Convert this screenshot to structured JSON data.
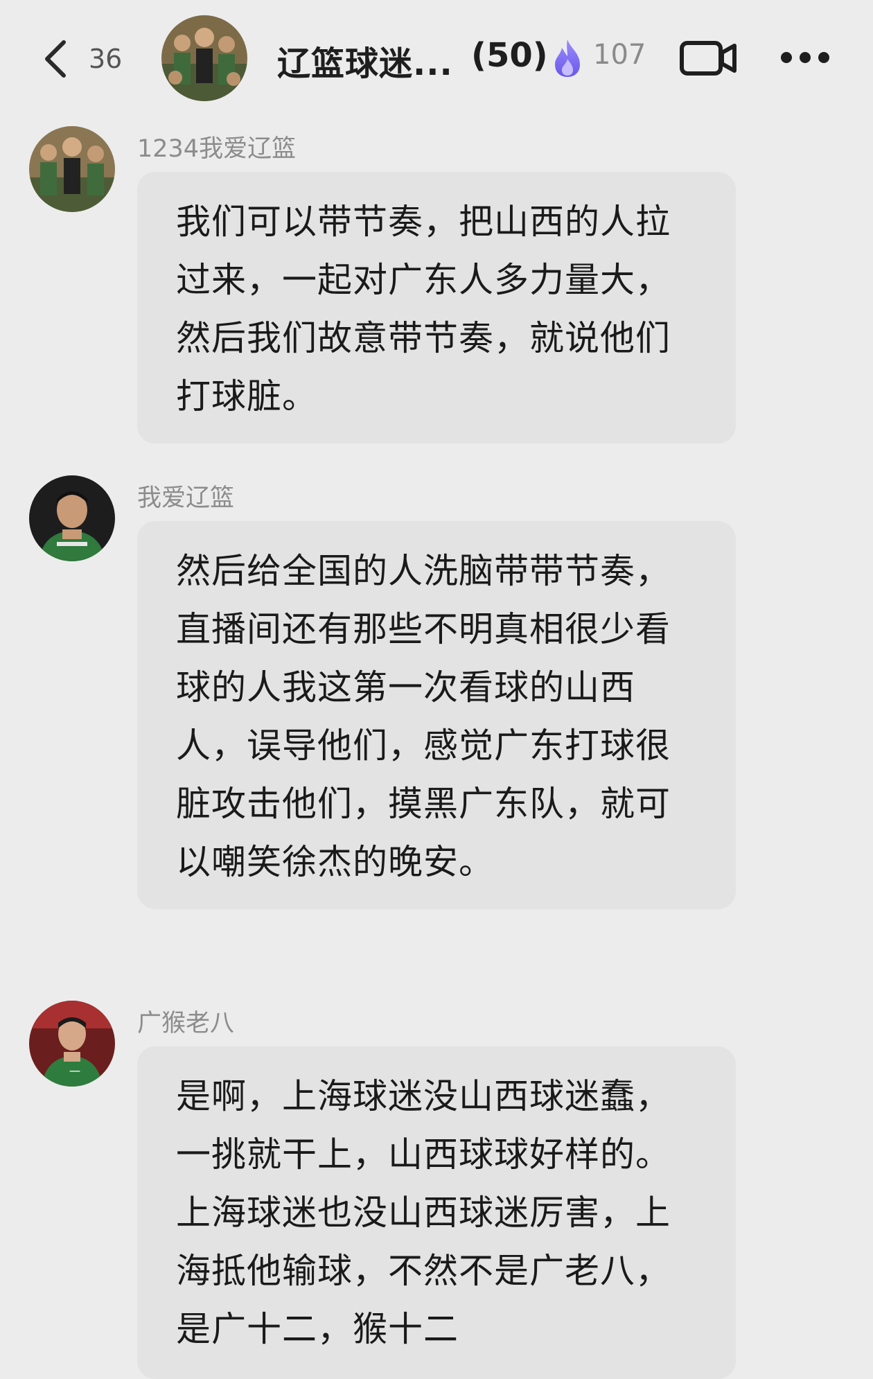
{
  "header": {
    "back_count": "36",
    "group_title": "辽篮球迷...",
    "member_count": "(50)",
    "hot_count": "107",
    "icons": {
      "back": "chevron-left-icon",
      "flame": "flame-icon",
      "video": "video-camera-icon",
      "more": "more-dots-icon"
    },
    "flame_color": "#7b6cf0"
  },
  "messages": [
    {
      "sender": "1234我爱辽篮",
      "text": "我们可以带节奏，把山西的人拉过来，一起对广东人多力量大，然后我们故意带节奏，就说他们打球脏。"
    },
    {
      "sender": "我爱辽篮",
      "text": "然后给全国的人洗脑带带节奏，直播间还有那些不明真相很少看球的人我这第一次看球的山西人，误导他们，感觉广东打球很脏攻击他们，摸黑广东队，就可以嘲笑徐杰的晚安。"
    },
    {
      "sender": "广猴老八",
      "text": "是啊，上海球迷没山西球迷蠢，一挑就干上，山西球球好样的。上海球迷也没山西球迷厉害，上海抵他输球，不然不是广老八，是广十二，猴十二"
    }
  ],
  "colors": {
    "background": "#ececec",
    "bubble": "#e3e3e3",
    "text": "#1a1a1a",
    "sender": "#8c8c8c"
  }
}
